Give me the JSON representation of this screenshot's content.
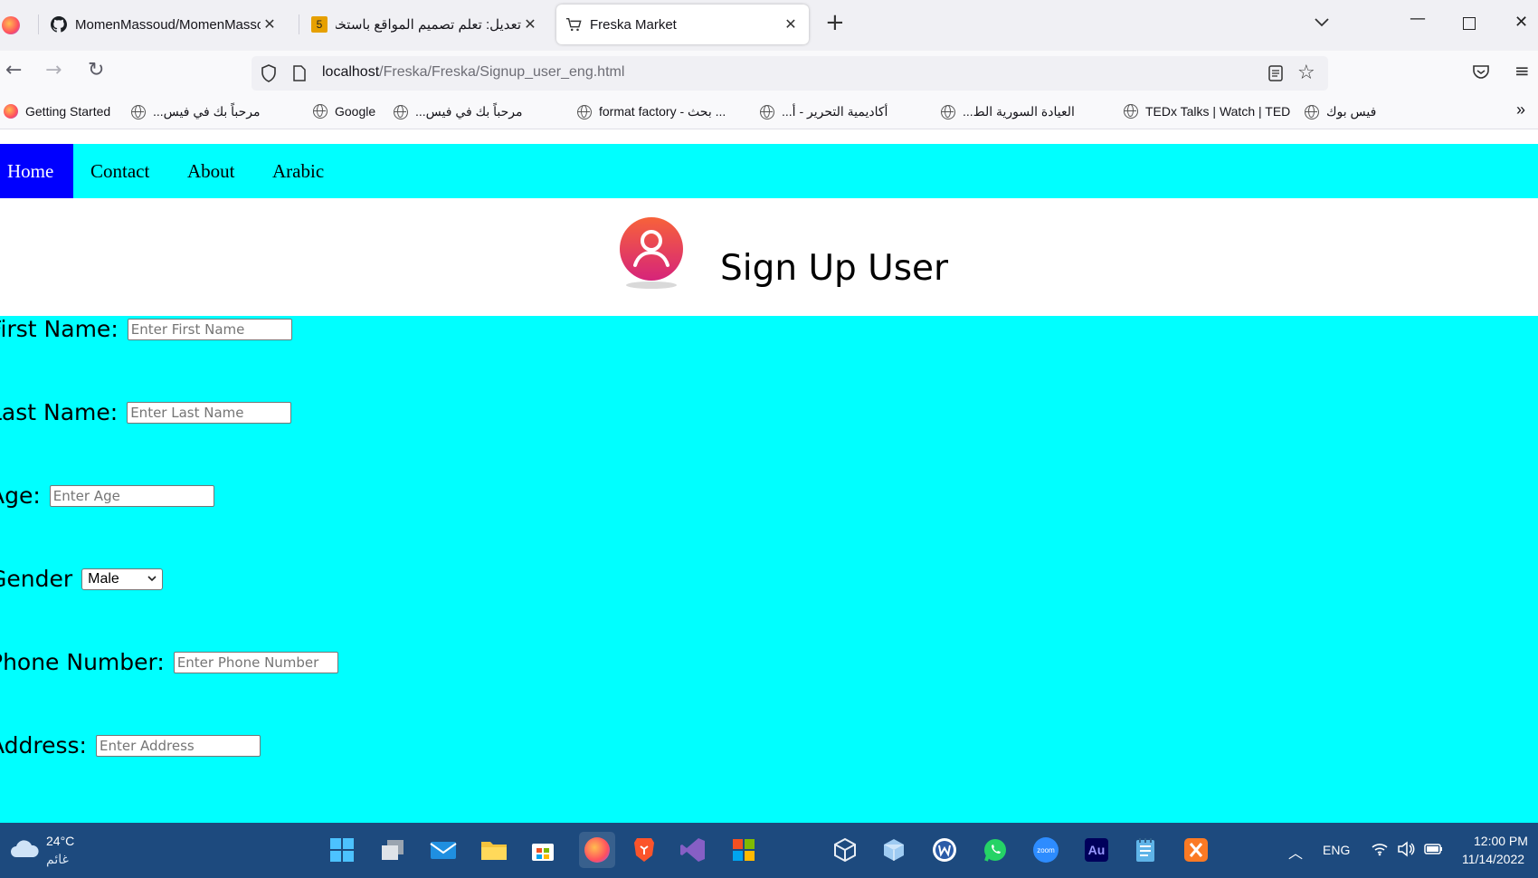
{
  "browser": {
    "tabs": [
      {
        "title": "MomenMassoud/MomenMassoud",
        "icon": "github-icon"
      },
      {
        "title": "تعديل: تعلم تصميم المواقع باستخدام",
        "icon": "html5-icon",
        "badge": "5"
      },
      {
        "title": "Freska Market",
        "icon": "cart-icon",
        "active": true
      }
    ],
    "url": {
      "host": "localhost",
      "path": "/Freska/Freska/Signup_user_eng.html"
    },
    "bookmarks": [
      {
        "label": "Getting Started"
      },
      {
        "label": "مرحباً بك في فيس..."
      },
      {
        "label": "Google"
      },
      {
        "label": "مرحباً بك في فيس..."
      },
      {
        "label": "format factory - بحث ..."
      },
      {
        "label": "أكاديمية التحرير - أ..."
      },
      {
        "label": "العيادة السورية الط..."
      },
      {
        "label": "TEDx Talks | Watch | TED"
      },
      {
        "label": "فيس بوك"
      }
    ]
  },
  "site": {
    "nav": [
      {
        "label": "Home",
        "active": true
      },
      {
        "label": "Contact"
      },
      {
        "label": "About"
      },
      {
        "label": "Arabic"
      }
    ],
    "title": "Sign Up User",
    "form": {
      "first_name": {
        "label": "First Name:",
        "placeholder": "Enter First Name"
      },
      "last_name": {
        "label": "Last Name:",
        "placeholder": "Enter Last Name"
      },
      "age": {
        "label": "Age:",
        "placeholder": "Enter Age"
      },
      "gender": {
        "label": "Gender",
        "selected": "Male"
      },
      "phone": {
        "label": "Phone Number:",
        "placeholder": "Enter Phone Number"
      },
      "address": {
        "label": "Address:",
        "placeholder": "Enter Address"
      }
    },
    "colors": {
      "nav_bg": "#00ffff",
      "nav_active": "#0000ff",
      "form_bg": "#00ffff"
    }
  },
  "taskbar": {
    "weather": {
      "temp": "24°C",
      "condition": "غائم"
    },
    "language": "ENG",
    "time": "12:00 PM",
    "date": "11/14/2022"
  }
}
